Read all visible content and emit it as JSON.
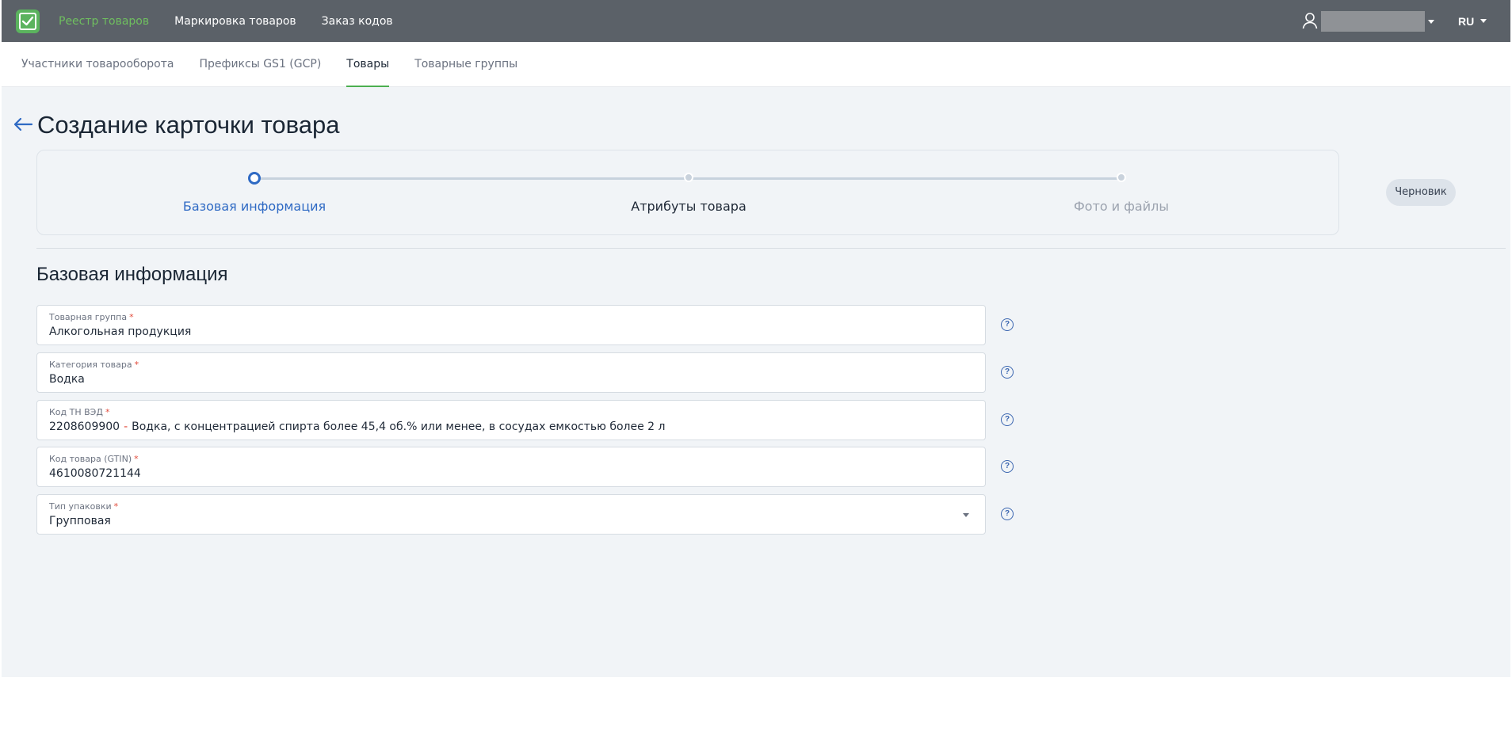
{
  "topbar": {
    "nav": [
      "Реестр товаров",
      "Маркировка товаров",
      "Заказ кодов"
    ],
    "active_nav": "Реестр товаров",
    "language": "RU"
  },
  "subnav": {
    "items": [
      "Участники товарооборота",
      "Префиксы GS1 (GCP)",
      "Товары",
      "Товарные группы"
    ],
    "active": "Товары"
  },
  "page": {
    "title": "Создание карточки товара",
    "status_badge": "Черновик"
  },
  "stepper": {
    "steps": [
      {
        "label": "Базовая информация",
        "state": "active"
      },
      {
        "label": "Атрибуты товара",
        "state": "upcoming"
      },
      {
        "label": "Фото и файлы",
        "state": "disabled"
      }
    ]
  },
  "form": {
    "section_title": "Базовая информация",
    "fields": [
      {
        "label": "Товарная группа",
        "value": "Алкогольная продукция",
        "required": "*"
      },
      {
        "label": "Категория товара",
        "value": "Водка",
        "required": "*"
      },
      {
        "label": "Код ТН ВЭД",
        "code": "2208609900",
        "separator": "-",
        "description": "Водка, с концентрацией спирта более 45,4 об.% или менее, в сосудах емкостью более 2 л",
        "required": "*"
      },
      {
        "label": "Код товара (GTIN)",
        "value": "4610080721144",
        "required": "*"
      },
      {
        "label": "Тип упаковки",
        "value": "Групповая",
        "required": "*"
      }
    ],
    "help_icon": "?"
  },
  "colors": {
    "topbar": "#5b6168",
    "accent_green": "#4caf50",
    "active_step": "#2f6ac4",
    "required_mark": "#e24b3b",
    "main_bg": "#f1f4f7"
  },
  "icons": [
    "app-logo-icon",
    "user-icon",
    "chevron-down-icon",
    "arrow-left-icon",
    "help-circle-icon"
  ]
}
